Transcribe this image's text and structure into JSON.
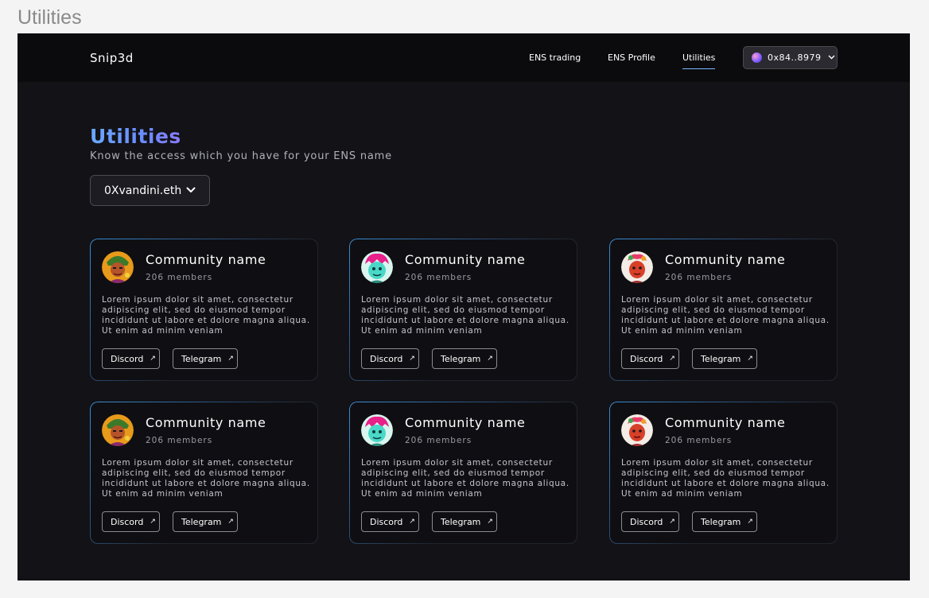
{
  "frame": {
    "label": "Utilities"
  },
  "nav": {
    "logo": "Snip3d",
    "links": [
      "ENS trading",
      "ENS Profile",
      "Utilities"
    ],
    "active": "Utilities",
    "wallet": {
      "address": "0x84..8979",
      "chevron": "chevron-down-icon"
    }
  },
  "header": {
    "title": "Utilities",
    "subtitle": "Know the access which you have for your ENS name"
  },
  "ens_select": {
    "value": "0Xvandini.eth"
  },
  "cards": [
    {
      "name": "Community name",
      "members": "206 members",
      "description": "Lorem ipsum dolor sit amet, consectetur adipiscing elit, sed do eiusmod tempor incididunt ut labore et dolore magna aliqua. Ut enim ad minim veniam",
      "discord": "Discord",
      "telegram": "Telegram",
      "avatar": "avatar-warrior"
    },
    {
      "name": "Community name",
      "members": "206 members",
      "description": "Lorem ipsum dolor sit amet, consectetur adipiscing elit, sed do eiusmod tempor incididunt ut labore et dolore magna aliqua. Ut enim ad minim veniam",
      "discord": "Discord",
      "telegram": "Telegram",
      "avatar": "avatar-cyan-face"
    },
    {
      "name": "Community name",
      "members": "206 members",
      "description": "Lorem ipsum dolor sit amet, consectetur adipiscing elit, sed do eiusmod tempor incididunt ut labore et dolore magna aliqua. Ut enim ad minim veniam",
      "discord": "Discord",
      "telegram": "Telegram",
      "avatar": "avatar-red-face"
    },
    {
      "name": "Community name",
      "members": "206 members",
      "description": "Lorem ipsum dolor sit amet, consectetur adipiscing elit, sed do eiusmod tempor incididunt ut labore et dolore magna aliqua. Ut enim ad minim veniam",
      "discord": "Discord",
      "telegram": "Telegram",
      "avatar": "avatar-warrior"
    },
    {
      "name": "Community name",
      "members": "206 members",
      "description": "Lorem ipsum dolor sit amet, consectetur adipiscing elit, sed do eiusmod tempor incididunt ut labore et dolore magna aliqua. Ut enim ad minim veniam",
      "discord": "Discord",
      "telegram": "Telegram",
      "avatar": "avatar-cyan-face"
    },
    {
      "name": "Community name",
      "members": "206 members",
      "description": "Lorem ipsum dolor sit amet, consectetur adipiscing elit, sed do eiusmod tempor incididunt ut labore et dolore magna aliqua. Ut enim ad minim veniam",
      "discord": "Discord",
      "telegram": "Telegram",
      "avatar": "avatar-red-face"
    }
  ],
  "colors": {
    "background": "#121217",
    "navbar": "#0b0b0d",
    "accent": "#6aa9ff",
    "card_border_accent": "#3b8fd6"
  }
}
